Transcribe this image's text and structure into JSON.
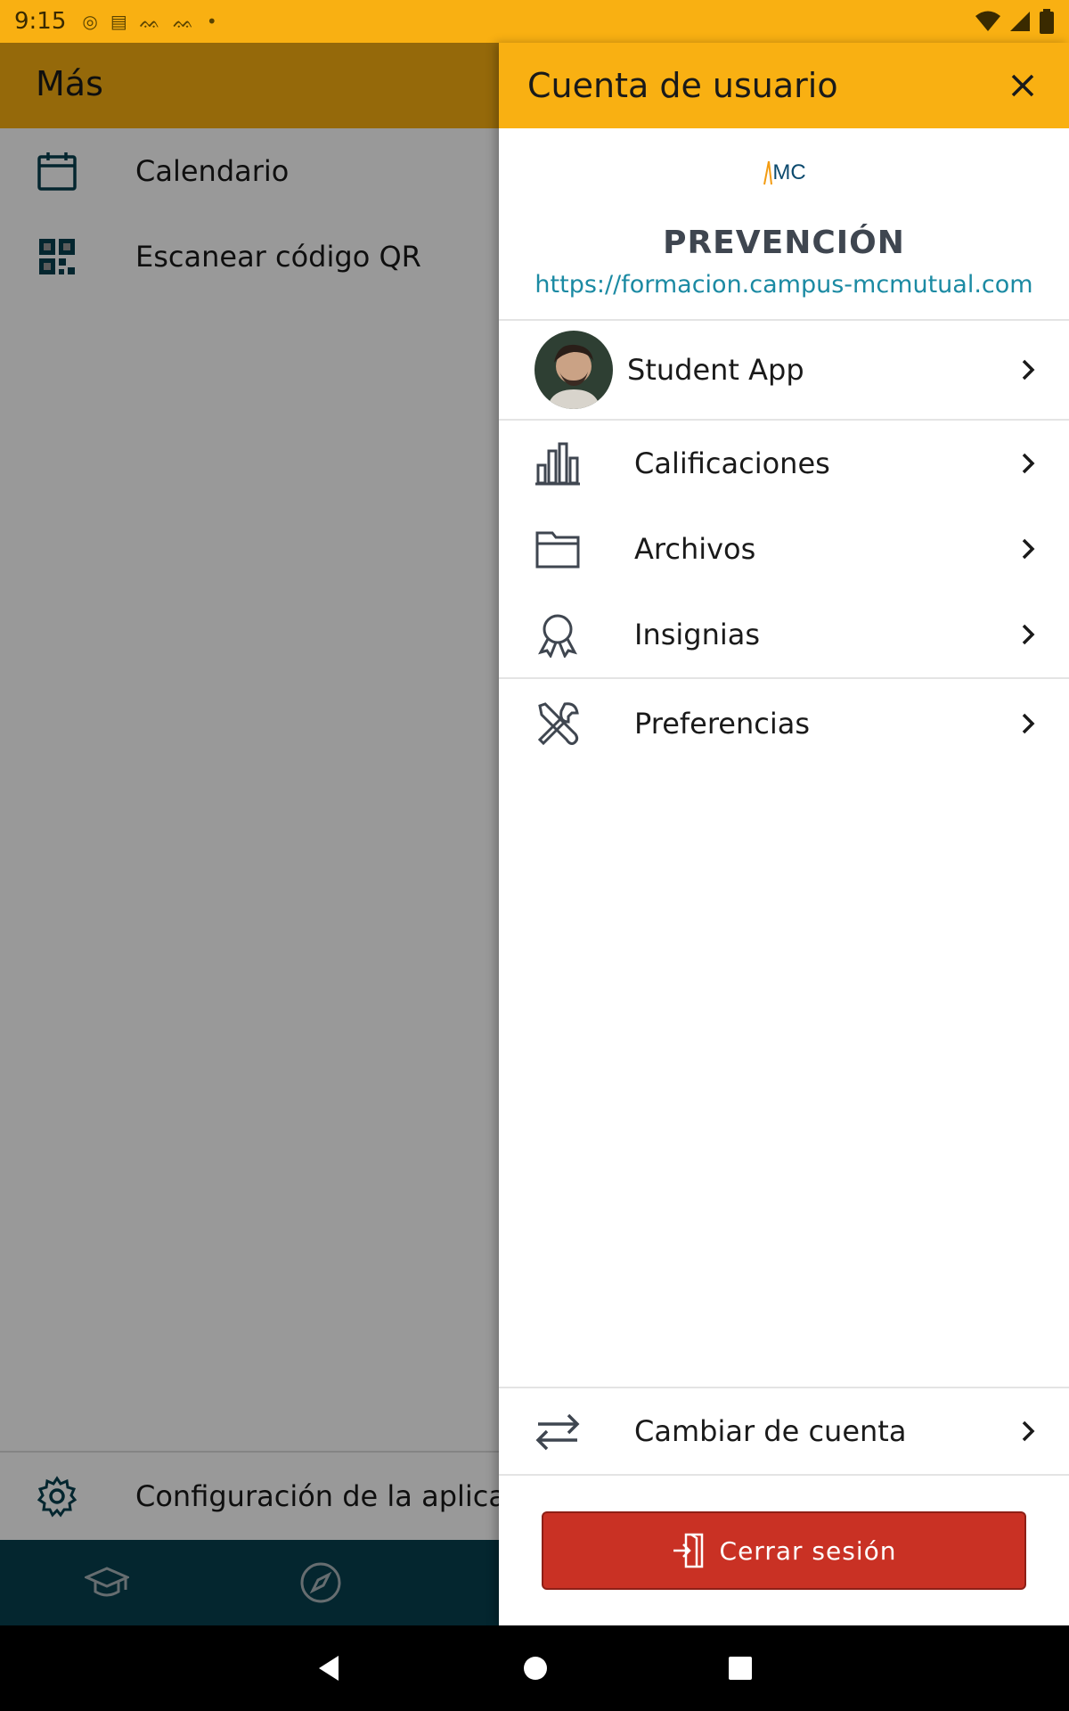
{
  "status_bar": {
    "time": "9:15"
  },
  "background": {
    "title": "Más",
    "items": [
      {
        "label": "Calendario",
        "icon": "calendar-icon"
      },
      {
        "label": "Escanear código QR",
        "icon": "qr-code-icon"
      }
    ],
    "config_label": "Configuración de la aplicación",
    "tabs": [
      "graduation-cap-icon",
      "compass-icon"
    ]
  },
  "drawer": {
    "title": "Cuenta de usuario",
    "site": {
      "logo_text": "MC",
      "name": "PREVENCIÓN",
      "url": "https://formacion.campus-mcmutual.com"
    },
    "user": {
      "name": "Student App"
    },
    "menu_items": [
      {
        "label": "Calificaciones",
        "icon": "bar-chart-icon"
      },
      {
        "label": "Archivos",
        "icon": "folder-icon"
      },
      {
        "label": "Insignias",
        "icon": "badge-icon"
      }
    ],
    "preferences": {
      "label": "Preferencias",
      "icon": "tools-icon"
    },
    "switch_account": {
      "label": "Cambiar de cuenta",
      "icon": "swap-icon"
    },
    "logout": {
      "label": "Cerrar sesión",
      "icon": "logout-icon"
    }
  },
  "colors": {
    "header": "#f9b012",
    "tabbar": "#07404f",
    "logout": "#c93124",
    "link": "#1b8aa3"
  }
}
